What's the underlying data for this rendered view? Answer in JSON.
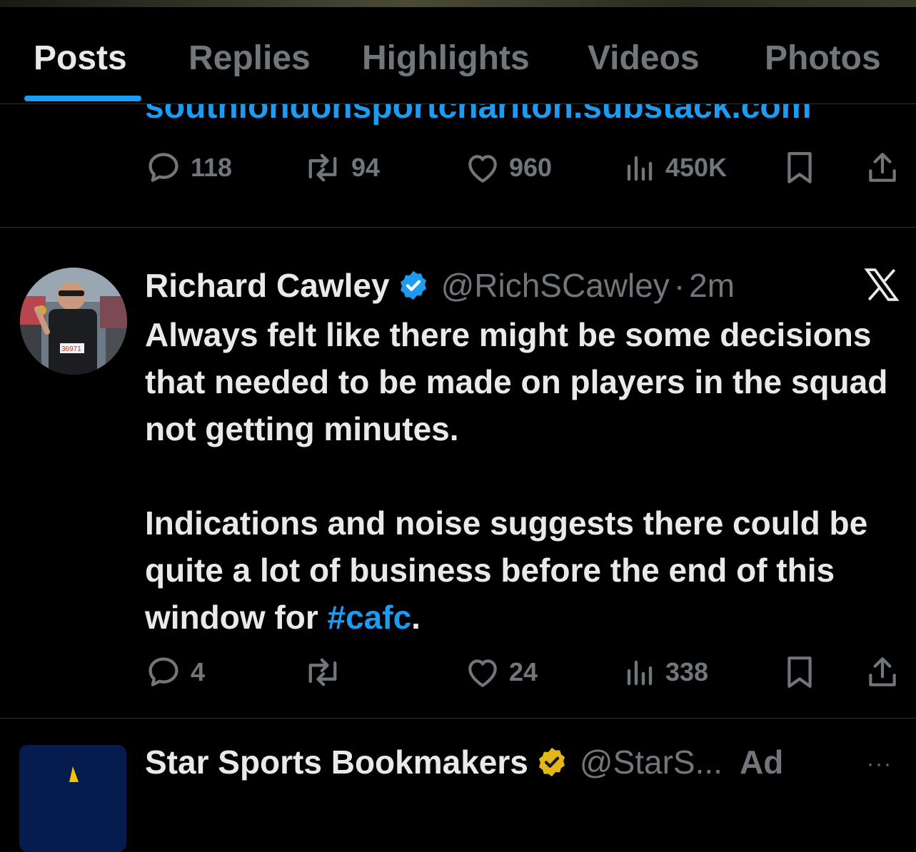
{
  "tabs": [
    {
      "label": "Posts",
      "active": true
    },
    {
      "label": "Replies",
      "active": false
    },
    {
      "label": "Highlights",
      "active": false
    },
    {
      "label": "Videos",
      "active": false
    },
    {
      "label": "Photos",
      "active": false
    }
  ],
  "accent_color": "#1d9bf0",
  "prev_post": {
    "link_text": "southlondonsportcharlton.substack.com",
    "replies": "118",
    "reposts": "94",
    "likes": "960",
    "views": "450K"
  },
  "post": {
    "name": "Richard Cawley",
    "handle": "@RichSCawley",
    "separator": "·",
    "time": "2m",
    "text_line1": "Always felt like there might be some decisions that needed to be made on players in the squad not getting minutes.",
    "text_line2_before": "Indications and noise suggests there could be quite a lot of business before the end of this window for ",
    "hashtag": "#cafc",
    "text_line2_after": ".",
    "replies": "4",
    "reposts": "",
    "likes": "24",
    "views": "338",
    "avatar_bib": "36971"
  },
  "ad_post": {
    "name": "Star Sports Bookmakers",
    "handle": "@StarS...",
    "ad_label": "Ad",
    "more": "···"
  }
}
